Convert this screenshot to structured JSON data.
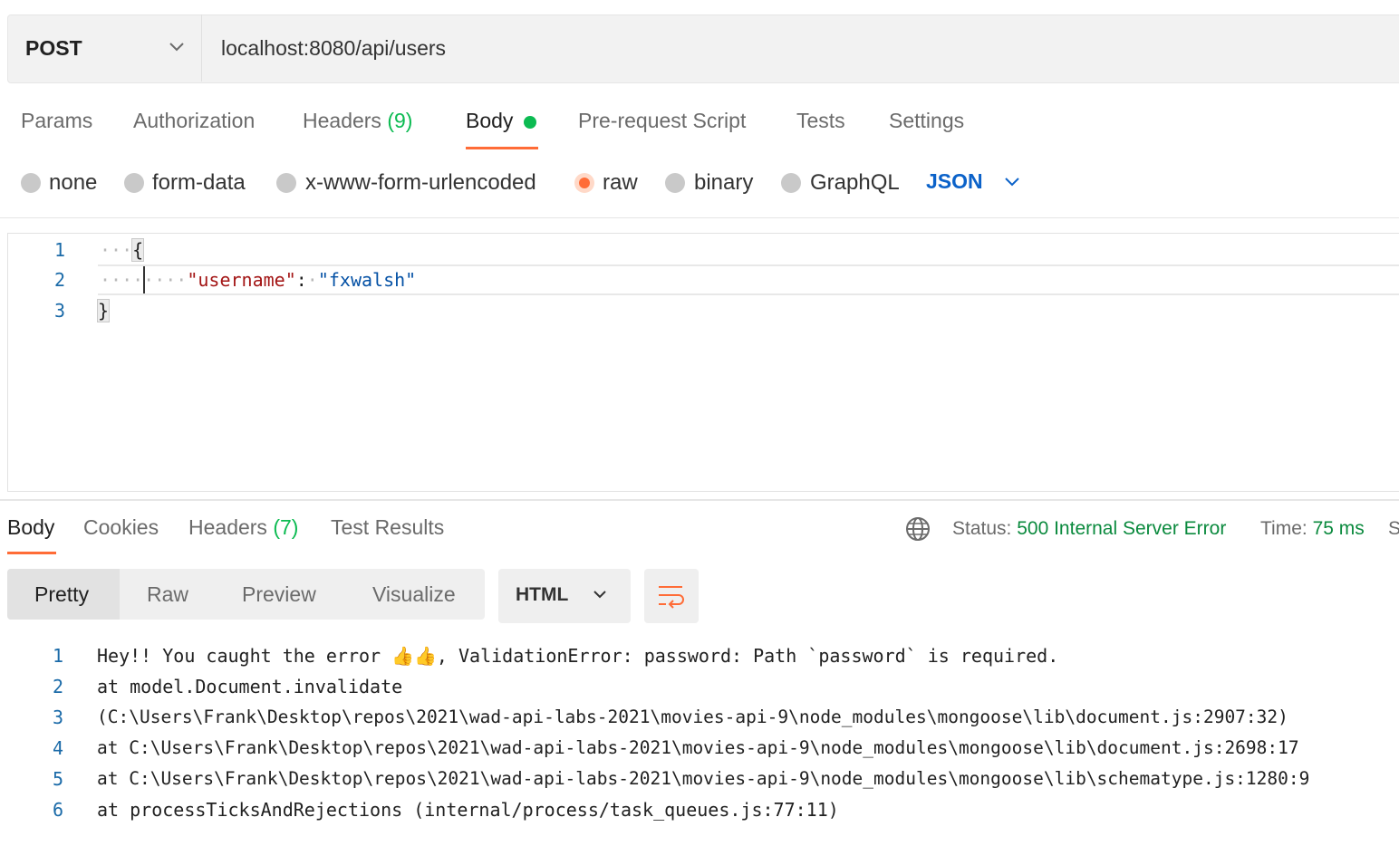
{
  "request": {
    "method": "POST",
    "url": "localhost:8080/api/users"
  },
  "request_tabs": {
    "params": "Params",
    "authorization": "Authorization",
    "headers": "Headers",
    "headers_count": "(9)",
    "body": "Body",
    "prerequest": "Pre-request Script",
    "tests": "Tests",
    "settings": "Settings",
    "active": "Body"
  },
  "body_types": {
    "none": "none",
    "form_data": "form-data",
    "urlencoded": "x-www-form-urlencoded",
    "raw": "raw",
    "binary": "binary",
    "graphql": "GraphQL",
    "selected": "raw",
    "language": "JSON"
  },
  "editor": {
    "line_numbers": [
      "1",
      "2",
      "3"
    ],
    "open_brace": "{",
    "key": "\"username\"",
    "colon": ":",
    "value": "\"fxwalsh\"",
    "close_brace": "}"
  },
  "response_tabs": {
    "body": "Body",
    "cookies": "Cookies",
    "headers": "Headers",
    "headers_count": "(7)",
    "test_results": "Test Results",
    "active": "Body"
  },
  "response_meta": {
    "status_label": "Status:",
    "status_value": "500 Internal Server Error",
    "time_label": "Time:",
    "time_value": "75 ms",
    "size_label_partial": "S"
  },
  "view_modes": {
    "pretty": "Pretty",
    "raw": "Raw",
    "preview": "Preview",
    "visualize": "Visualize",
    "active": "Pretty",
    "format": "HTML"
  },
  "response_body": {
    "line_numbers": [
      "1",
      "2",
      "3",
      "4",
      "5",
      "6"
    ],
    "lines": [
      "Hey!! You caught the error 👍👍, ValidationError: password: Path `password` is required.",
      "at model.Document.invalidate",
      "(C:\\Users\\Frank\\Desktop\\repos\\2021\\wad-api-labs-2021\\movies-api-9\\node_modules\\mongoose\\lib\\document.js:2907:32)",
      "at C:\\Users\\Frank\\Desktop\\repos\\2021\\wad-api-labs-2021\\movies-api-9\\node_modules\\mongoose\\lib\\document.js:2698:17",
      "at C:\\Users\\Frank\\Desktop\\repos\\2021\\wad-api-labs-2021\\movies-api-9\\node_modules\\mongoose\\lib\\schematype.js:1280:9",
      "at processTicksAndRejections (internal/process/task_queues.js:77:11)"
    ]
  },
  "colors": {
    "accent": "#ff6c37",
    "success": "#0cbb52",
    "link_blue": "#0b62c9"
  },
  "icons": [
    "chevron-down-icon",
    "globe-icon",
    "wrap-lines-icon"
  ]
}
